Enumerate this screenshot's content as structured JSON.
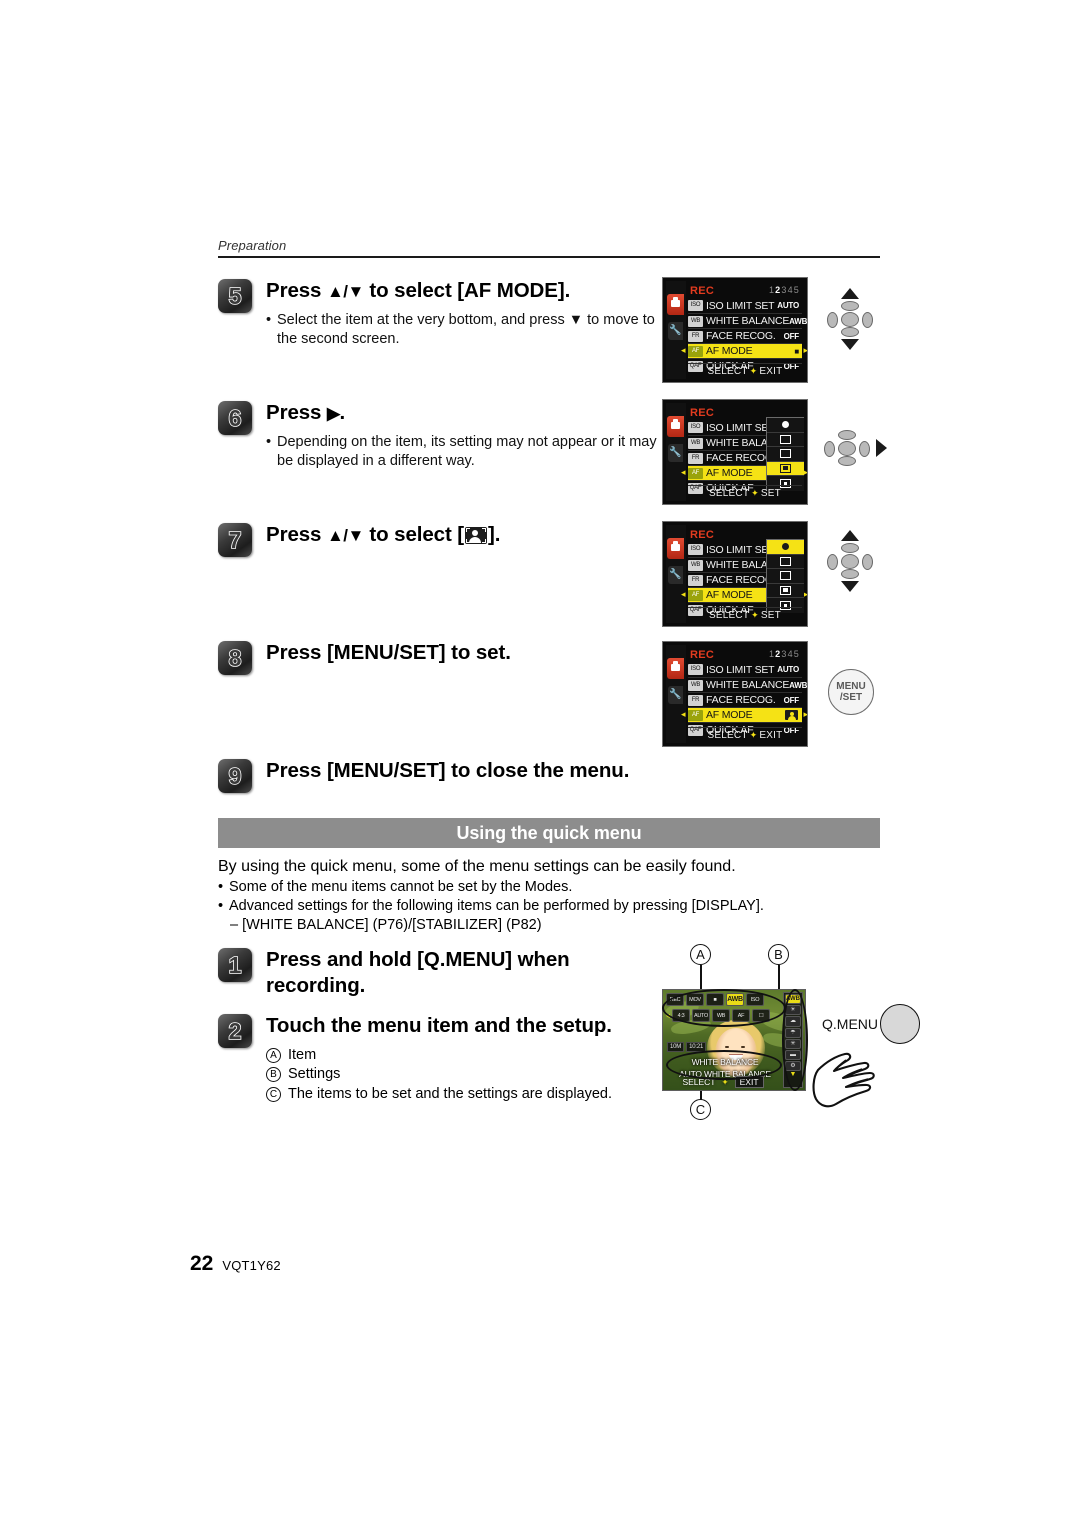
{
  "header": {
    "section_label": "Preparation"
  },
  "steps": [
    {
      "num": "5",
      "title_pre": "Press ",
      "title_arrows": "▲/▼",
      "title_post": " to select [AF MODE].",
      "bullets": [
        "Select the item at the very bottom, and press ▼ to move to the second screen."
      ]
    },
    {
      "num": "6",
      "title_pre": "Press ",
      "title_arrows": "▶",
      "title_post": ".",
      "bullets": [
        "Depending on the item, its setting may not appear or it may be displayed in a different way."
      ]
    },
    {
      "num": "7",
      "title_pre": "Press ",
      "title_arrows": "▲/▼",
      "title_post": " to select [",
      "title_end": "].",
      "bullets": []
    },
    {
      "num": "8",
      "title_pre": "Press [MENU/SET] to set.",
      "title_arrows": "",
      "title_post": "",
      "bullets": []
    },
    {
      "num": "9",
      "title_pre": "Press [MENU/SET] to close the menu.",
      "title_arrows": "",
      "title_post": "",
      "bullets": []
    }
  ],
  "lcd": {
    "title": "REC",
    "page_indicator": {
      "active": "2",
      "others_left": "1",
      "others_right": "345"
    },
    "items": [
      {
        "icon": "iso-icon",
        "icon_text": "ISO",
        "label": "ISO LIMIT SET",
        "value": "AUTO"
      },
      {
        "icon": "white-balance-icon",
        "icon_text": "WB",
        "label": "WHITE BALANCE",
        "value": "AWB"
      },
      {
        "icon": "face-recog-icon",
        "icon_text": "FR",
        "label": "FACE RECOG.",
        "value": "OFF"
      },
      {
        "icon": "af-mode-icon",
        "icon_text": "AF",
        "label": "AF MODE",
        "value": "■"
      },
      {
        "icon": "quick-af-icon",
        "icon_text": "QAF",
        "label": "QUICK AF",
        "value": "OFF"
      }
    ],
    "items_truncated": [
      {
        "label": "ISO LIMIT SET"
      },
      {
        "label": "WHITE BALANC"
      },
      {
        "label": "FACE RECOG."
      },
      {
        "label": "AF MODE"
      },
      {
        "label": "QUICK AF"
      }
    ],
    "footer_select": "SELECT",
    "footer_exit": "EXIT",
    "footer_set": "SET",
    "af_options": [
      {
        "name": "face-detection-af-icon"
      },
      {
        "name": "af-tracking-icon"
      },
      {
        "name": "multi-area-af-icon"
      },
      {
        "name": "one-area-af-icon"
      },
      {
        "name": "spot-af-icon"
      }
    ],
    "selected_index_screen2": 3,
    "selected_index_screen3": 0
  },
  "controls": {
    "cursor_pad_name": "cursor-pad",
    "menu_set_line1": "MENU",
    "menu_set_line2": "/SET"
  },
  "quick_menu_section": {
    "banner": "Using the quick menu",
    "lead": "By using the quick menu, some of the menu settings can be easily found.",
    "bullets": [
      "Some of the menu items cannot be set by the Modes.",
      "Advanced settings for the following items can be performed by pressing [DISPLAY]."
    ],
    "sub_bullet": "– [WHITE BALANCE] (P76)/[STABILIZER] (P82)",
    "steps": [
      {
        "num": "1",
        "title": "Press and hold [Q.MENU] when recording."
      },
      {
        "num": "2",
        "title": "Touch the menu item and the setup."
      }
    ],
    "legend": [
      {
        "marker": "A",
        "text": "Item"
      },
      {
        "marker": "B",
        "text": "Settings"
      },
      {
        "marker": "C",
        "text": "The items to be set and the settings are displayed."
      }
    ]
  },
  "quick_menu_screen": {
    "marker_a": "A",
    "marker_b": "B",
    "marker_c": "C",
    "row1": [
      {
        "label": "REC"
      },
      {
        "label": "MOV"
      },
      {
        "label": "■"
      },
      {
        "label": "AWB",
        "highlight": true
      },
      {
        "label": "ISO"
      }
    ],
    "row2": [
      {
        "label": "4:3"
      },
      {
        "label": "AUTO"
      },
      {
        "label": "WB"
      },
      {
        "label": "AF"
      },
      {
        "label": "☐"
      }
    ],
    "resolution_chips": [
      "10M",
      "10:21"
    ],
    "title_line": "WHITE BALANCE",
    "value_line": "AUTO WHITE BALANCE",
    "footer_select": "SELECT",
    "footer_exit": "EXIT",
    "side_options": [
      {
        "label": "AWB",
        "selected": true
      },
      {
        "label": "☀"
      },
      {
        "label": "☁"
      },
      {
        "label": "☂"
      },
      {
        "label": "✳"
      },
      {
        "label": "▬"
      },
      {
        "label": "⚙"
      }
    ],
    "q_menu_label": "Q.MENU",
    "hand_icon": "touch-hand-icon"
  },
  "footer": {
    "page_number": "22",
    "doc_code": "VQT1Y62"
  },
  "colors": {
    "highlight_yellow": "#f5e215",
    "rec_red": "#e03b1f",
    "banner_gray": "#8d8d8d"
  }
}
